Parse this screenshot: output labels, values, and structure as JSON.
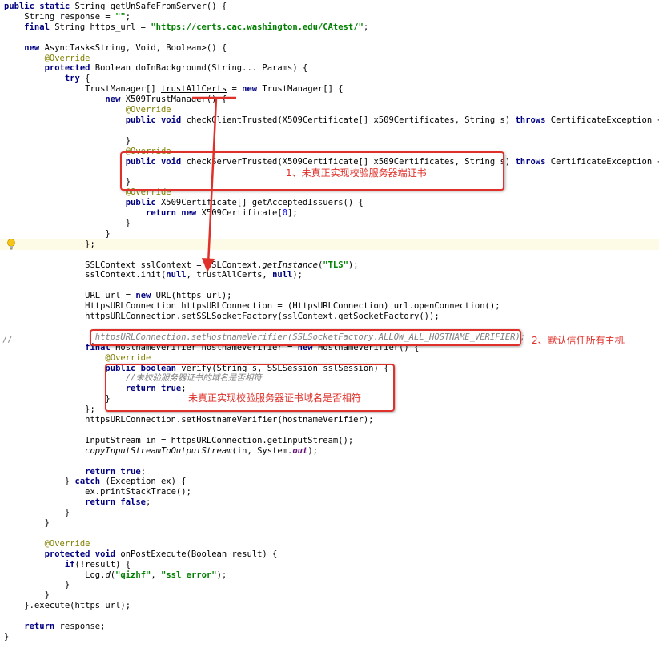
{
  "editor": {
    "lines": [
      [
        [
          "kw",
          "public static "
        ],
        [
          "",
          "String getUnSafeFromServer() {"
        ]
      ],
      [
        [
          "",
          "    String response = "
        ],
        [
          "str",
          "\"\""
        ],
        [
          "",
          ";"
        ]
      ],
      [
        [
          "kw",
          "    final "
        ],
        [
          "",
          "String https_url = "
        ],
        [
          "str",
          "\"https://certs.cac.washington.edu/CAtest/\""
        ],
        [
          "",
          ";"
        ]
      ],
      [],
      [
        [
          "kw",
          "    new "
        ],
        [
          "",
          "AsyncTask<String, Void, Boolean>() {"
        ]
      ],
      [
        [
          "ann",
          "        @Override"
        ]
      ],
      [
        [
          "kw",
          "        protected "
        ],
        [
          "",
          "Boolean doInBackground(String... Params) {"
        ]
      ],
      [
        [
          "kw",
          "            try "
        ],
        [
          "",
          "{"
        ]
      ],
      [
        [
          "",
          "                TrustManager[] "
        ],
        [
          "ul",
          "trustAllCerts"
        ],
        [
          "",
          " = "
        ],
        [
          "kw",
          "new "
        ],
        [
          "",
          "TrustManager[] {"
        ]
      ],
      [
        [
          "kw",
          "                    new "
        ],
        [
          "",
          "X509TrustManager() {"
        ]
      ],
      [
        [
          "ann",
          "                        @Override"
        ]
      ],
      [
        [
          "kw",
          "                        public void "
        ],
        [
          "",
          "checkClientTrusted(X509Certificate[] x509Certificates, String s) "
        ],
        [
          "kw",
          "throws "
        ],
        [
          "",
          "CertificateException {"
        ]
      ],
      [],
      [
        [
          "",
          "                        }"
        ]
      ],
      [
        [
          "ann",
          "                        @Override"
        ]
      ],
      [
        [
          "kw",
          "                        public void "
        ],
        [
          "",
          "checkServerTrusted(X509Certificate[] x509Certificates, String s) "
        ],
        [
          "kw",
          "throws "
        ],
        [
          "",
          "CertificateException {"
        ]
      ],
      [],
      [
        [
          "",
          "                        }"
        ]
      ],
      [
        [
          "ann",
          "                        @Override"
        ]
      ],
      [
        [
          "kw",
          "                        public "
        ],
        [
          "",
          "X509Certificate[] getAcceptedIssuers() {"
        ]
      ],
      [
        [
          "kw",
          "                            return new "
        ],
        [
          "",
          "X509Certificate["
        ],
        [
          "num",
          "0"
        ],
        [
          "",
          "];"
        ]
      ],
      [
        [
          "",
          "                        }"
        ]
      ],
      [
        [
          "",
          "                    }"
        ]
      ],
      [
        [
          "",
          "                };"
        ]
      ],
      [],
      [
        [
          "",
          "                SSLContext sslContext = SSLContext."
        ],
        [
          "ital",
          "getInstance"
        ],
        [
          "",
          "("
        ],
        [
          "str",
          "\"TLS\""
        ],
        [
          "",
          ");"
        ]
      ],
      [
        [
          "",
          "                sslContext.init("
        ],
        [
          "kw",
          "null"
        ],
        [
          "",
          ", trustAllCerts, "
        ],
        [
          "kw",
          "null"
        ],
        [
          "",
          ");"
        ]
      ],
      [],
      [
        [
          "",
          "                URL url = "
        ],
        [
          "kw",
          "new "
        ],
        [
          "",
          "URL(https_url);"
        ]
      ],
      [
        [
          "",
          "                HttpsURLConnection httpsURLConnection = (HttpsURLConnection) url.openConnection();"
        ]
      ],
      [
        [
          "",
          "                httpsURLConnection.setSSLSocketFactory(sslContext.getSocketFactory());"
        ]
      ],
      [],
      [
        [
          "cmt",
          "                  httpsURLConnection.setHostnameVerifier(SSLSocketFactory.ALLOW_ALL_HOSTNAME_VERIFIER);"
        ]
      ],
      [
        [
          "kw",
          "                final "
        ],
        [
          "",
          "HostnameVerifier hostnameVerifier = "
        ],
        [
          "kw",
          "new "
        ],
        [
          "",
          "HostnameVerifier() {"
        ]
      ],
      [
        [
          "ann",
          "                    @Override"
        ]
      ],
      [
        [
          "kw",
          "                    public boolean "
        ],
        [
          "",
          "verify(String s, SSLSession sslSession) {"
        ]
      ],
      [
        [
          "cmt",
          "                        //未校验服务器证书的域名是否相符"
        ]
      ],
      [
        [
          "kw",
          "                        return true"
        ],
        [
          "",
          ";"
        ]
      ],
      [
        [
          "",
          "                    }"
        ]
      ],
      [
        [
          "",
          "                };"
        ]
      ],
      [
        [
          "",
          "                httpsURLConnection.setHostnameVerifier(hostnameVerifier);"
        ]
      ],
      [],
      [
        [
          "",
          "                InputStream in = httpsURLConnection.getInputStream();"
        ]
      ],
      [
        [
          "ital",
          "                copyInputStreamToOutputStream"
        ],
        [
          "",
          "(in, System."
        ],
        [
          "fld",
          "out"
        ],
        [
          "",
          ");"
        ]
      ],
      [],
      [
        [
          "kw",
          "                return true"
        ],
        [
          "",
          ";"
        ]
      ],
      [
        [
          "",
          "            } "
        ],
        [
          "kw",
          "catch "
        ],
        [
          "",
          "(Exception ex) {"
        ]
      ],
      [
        [
          "",
          "                ex.printStackTrace();"
        ]
      ],
      [
        [
          "kw",
          "                return false"
        ],
        [
          "",
          ";"
        ]
      ],
      [
        [
          "",
          "            }"
        ]
      ],
      [
        [
          "",
          "        }"
        ]
      ],
      [],
      [
        [
          "ann",
          "        @Override"
        ]
      ],
      [
        [
          "kw",
          "        protected void "
        ],
        [
          "",
          "onPostExecute(Boolean result) {"
        ]
      ],
      [
        [
          "kw",
          "            if"
        ],
        [
          "",
          "(!result) {"
        ]
      ],
      [
        [
          "",
          "                Log."
        ],
        [
          "ital",
          "d"
        ],
        [
          "",
          "("
        ],
        [
          "str",
          "\"qizhf\""
        ],
        [
          "",
          ", "
        ],
        [
          "str",
          "\"ssl error\""
        ],
        [
          "",
          ");"
        ]
      ],
      [
        [
          "",
          "            }"
        ]
      ],
      [
        [
          "",
          "        }"
        ]
      ],
      [
        [
          "",
          "    }.execute(https_url);"
        ]
      ],
      [],
      [
        [
          "kw",
          "    return "
        ],
        [
          "",
          "response;"
        ]
      ],
      [
        [
          "",
          "}"
        ]
      ]
    ],
    "gutter_comment_marker": "//",
    "highlighted_line_index": 23
  },
  "annotations": {
    "note1": "1、未真正实现校验服务器端证书",
    "note2": "2、默认信任所有主机",
    "note3": "未真正实现校验服务器证书域名是否相符"
  },
  "colors": {
    "keyword": "#000080",
    "string": "#008000",
    "annotation": "#808000",
    "comment": "#808080",
    "number": "#0000ff",
    "markup_red": "#e0302a",
    "current_line": "#fdfbe5"
  }
}
